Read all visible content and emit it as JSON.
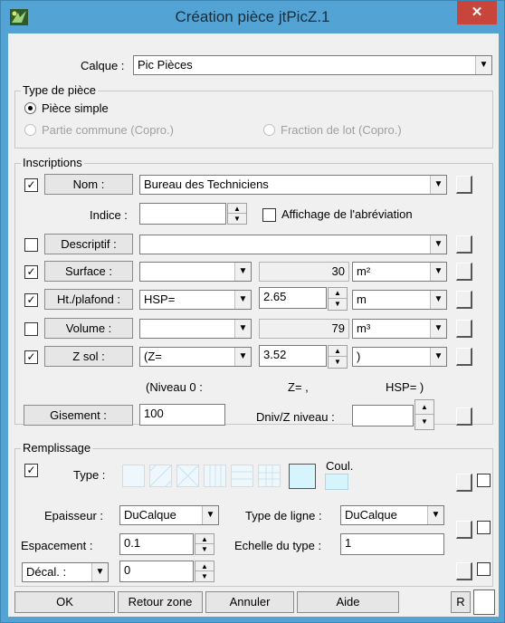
{
  "window": {
    "title": "Création pièce jtPicZ.1",
    "close_glyph": "✕"
  },
  "calque": {
    "label": "Calque :",
    "value": "Pic Pièces"
  },
  "type_piece": {
    "legend": "Type de pièce",
    "options": [
      "Pièce simple",
      "Partie commune (Copro.)",
      "Fraction de lot (Copro.)"
    ],
    "selected": "Pièce simple"
  },
  "inscriptions": {
    "legend": "Inscriptions",
    "nom": {
      "label": "Nom :",
      "value": "Bureau des Techniciens",
      "checked": true
    },
    "indice": {
      "label": "Indice :",
      "value": "",
      "abbrev_label": "Affichage de l'abréviation",
      "abbrev_checked": false
    },
    "descriptif": {
      "label": "Descriptif :",
      "value": "",
      "checked": false
    },
    "surface": {
      "label": "Surface :",
      "combo": "",
      "value": "30",
      "unit": "m²",
      "checked": true
    },
    "ht_plafond": {
      "label": "Ht./plafond :",
      "combo": "HSP=",
      "value": "2.65",
      "unit": "m",
      "checked": true
    },
    "volume": {
      "label": "Volume :",
      "combo": "",
      "value": "79",
      "unit": "m³",
      "checked": false
    },
    "z_sol": {
      "label": "Z sol :",
      "combo": "(Z=",
      "value": "3.52",
      "unit": ")",
      "checked": true
    },
    "niveau_row": {
      "niveau": "(Niveau 0 :",
      "z": "Z= ,",
      "hsp": "HSP= )"
    },
    "gisement": {
      "label": "Gisement :",
      "value": "100"
    },
    "dniv": {
      "label": "Dniv/Z niveau :",
      "value": ""
    }
  },
  "remplissage": {
    "legend": "Remplissage",
    "type_label": "Type :",
    "coul_label": "Coul.",
    "checked": true,
    "epaisseur": {
      "label": "Epaisseur :",
      "value": "DuCalque"
    },
    "type_ligne": {
      "label": "Type de ligne :",
      "value": "DuCalque"
    },
    "espacement": {
      "label": "Espacement :",
      "value": "0.1"
    },
    "echelle": {
      "label": "Echelle du type :",
      "value": "1"
    },
    "decal": {
      "label": "Décal. :",
      "value": "0"
    }
  },
  "footer": {
    "ok": "OK",
    "retour_zone": "Retour zone",
    "annuler": "Annuler",
    "aide": "Aide",
    "r": "R"
  },
  "icons": {
    "app": "drafting-app-icon",
    "close": "close-icon",
    "check": "✓",
    "dropdown": "▼",
    "spin_up": "▲",
    "spin_down": "▼"
  },
  "colors": {
    "title_bar": "#53a4d4",
    "close_button": "#c7453a",
    "dialog": "#f0f0f0",
    "swatch_selected": "#d6f4fb"
  }
}
